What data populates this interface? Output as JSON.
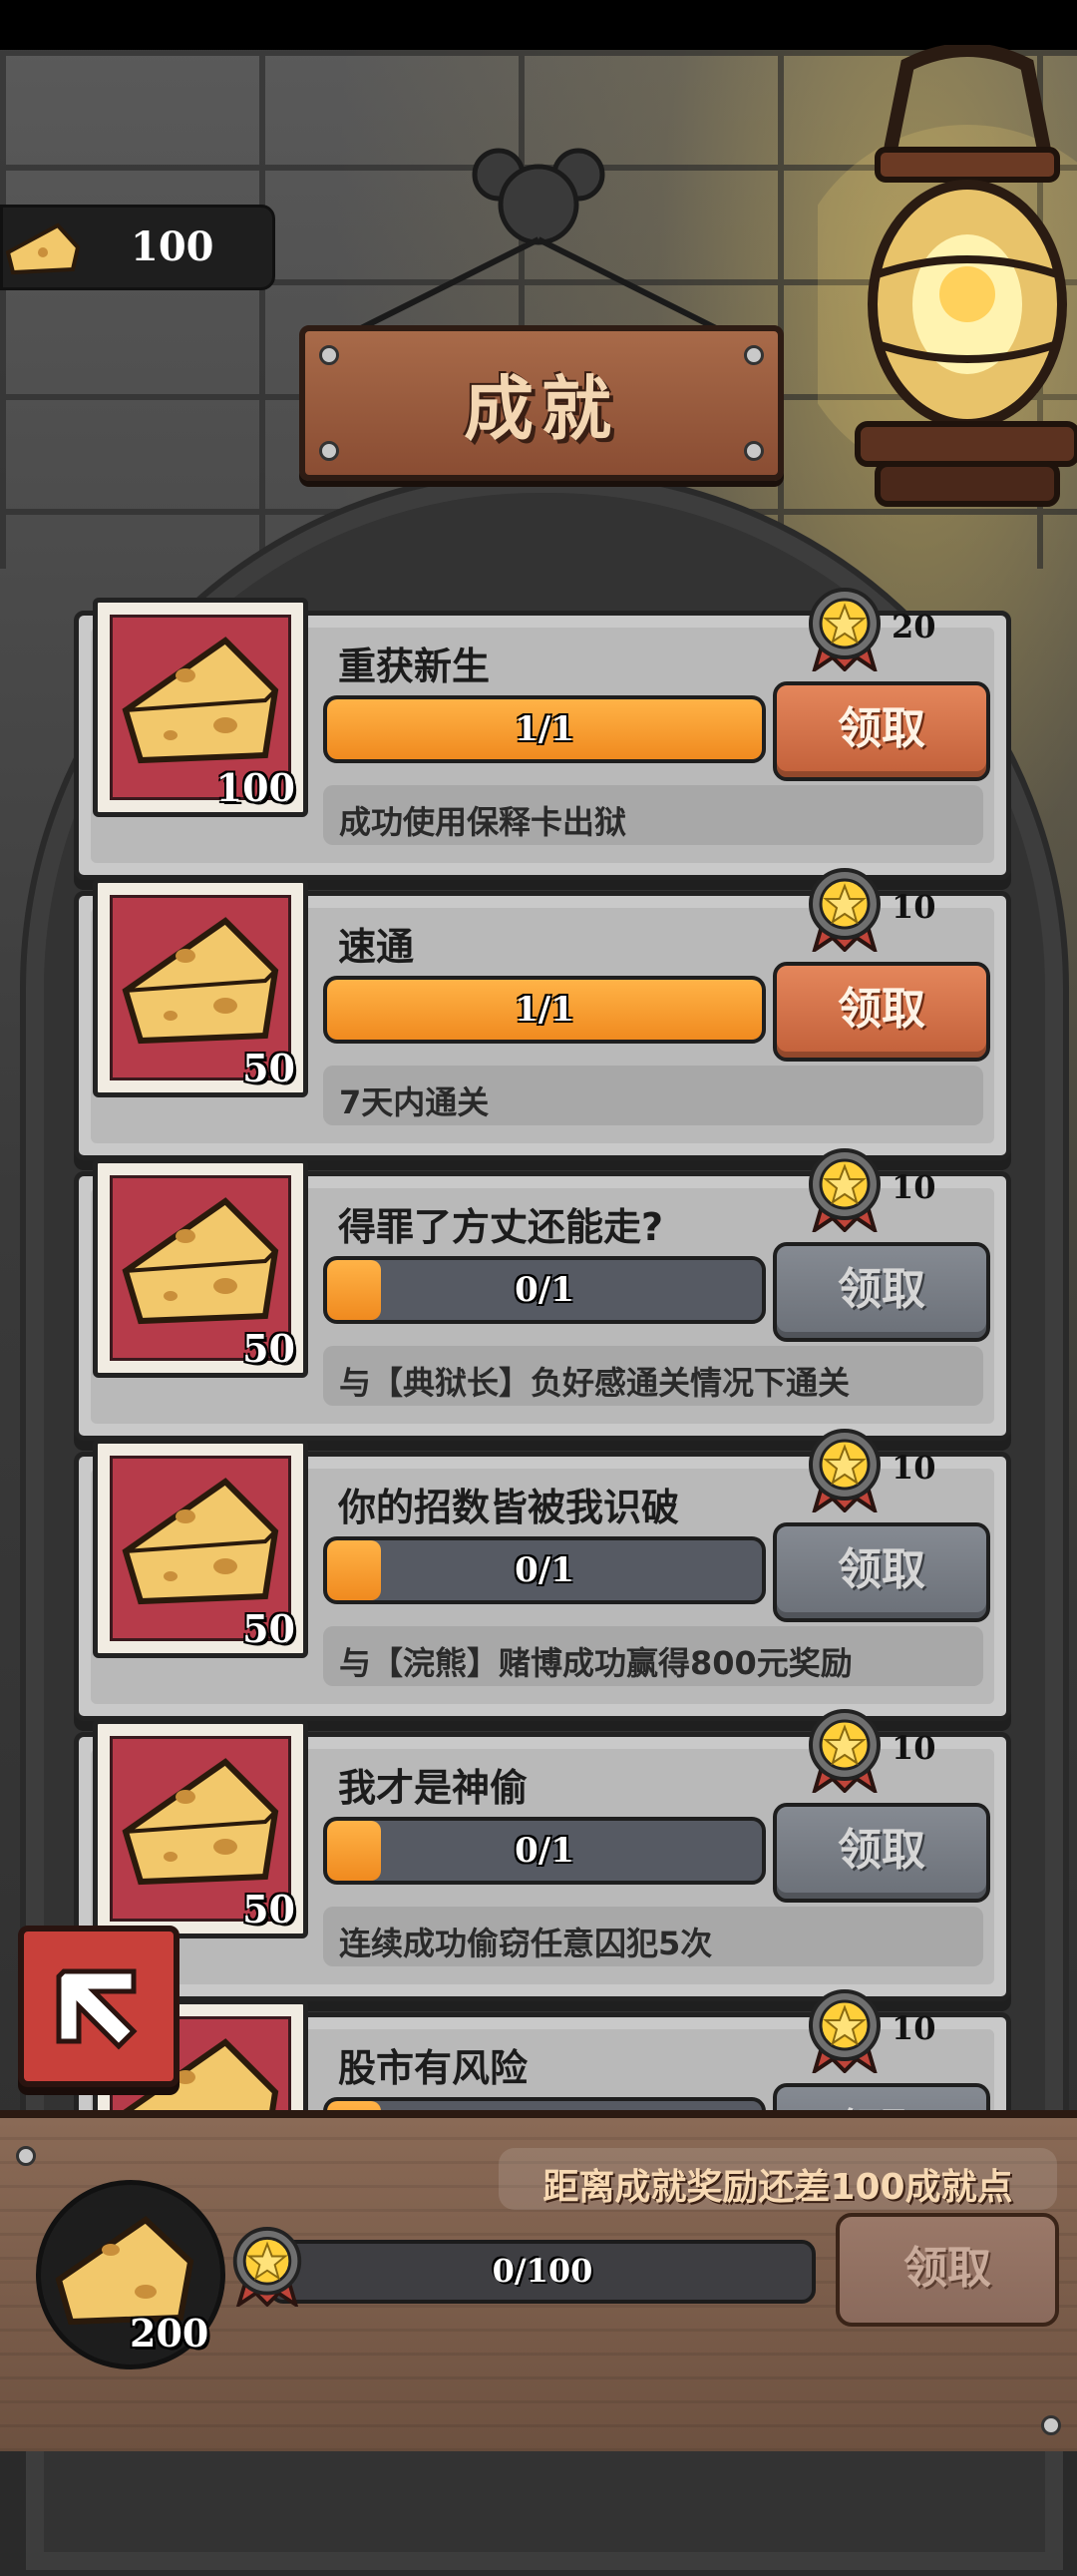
{
  "header": {
    "currency_value": "100",
    "title": "成就"
  },
  "achievements": [
    {
      "title": "重获新生",
      "progress_text": "1/1",
      "progress": 1.0,
      "description": "成功使用保释卡出狱",
      "reward": "100",
      "points": "20",
      "claim_label": "领取",
      "claimable": true
    },
    {
      "title": "速通",
      "progress_text": "1/1",
      "progress": 1.0,
      "description": "7天内通关",
      "reward": "50",
      "points": "10",
      "claim_label": "领取",
      "claimable": true
    },
    {
      "title": "得罪了方丈还能走?",
      "progress_text": "0/1",
      "progress": 0.0,
      "description": "与【典狱长】负好感通关情况下通关",
      "reward": "50",
      "points": "10",
      "claim_label": "领取",
      "claimable": false
    },
    {
      "title": "你的招数皆被我识破",
      "progress_text": "0/1",
      "progress": 0.0,
      "description": "与【浣熊】赌博成功赢得800元奖励",
      "reward": "50",
      "points": "10",
      "claim_label": "领取",
      "claimable": false
    },
    {
      "title": "我才是神偷",
      "progress_text": "0/1",
      "progress": 0.0,
      "description": "连续成功偷窃任意囚犯5次",
      "reward": "50",
      "points": "10",
      "claim_label": "领取",
      "claimable": false
    },
    {
      "title": "股市有风险",
      "progress_text": "",
      "progress": 0.0,
      "description": "",
      "reward": "",
      "points": "10",
      "claim_label": "领取",
      "claimable": false
    }
  ],
  "footer": {
    "remaining_text": "距离成就奖励还差100成就点",
    "total_progress_text": "0/100",
    "total_reward": "200",
    "claim_label": "领取"
  },
  "colors": {
    "accent_orange": "#f08a1f",
    "claim_active": "#c2603a",
    "claim_disabled": "#6b7078",
    "icon_bg_red": "#b63b4a"
  }
}
